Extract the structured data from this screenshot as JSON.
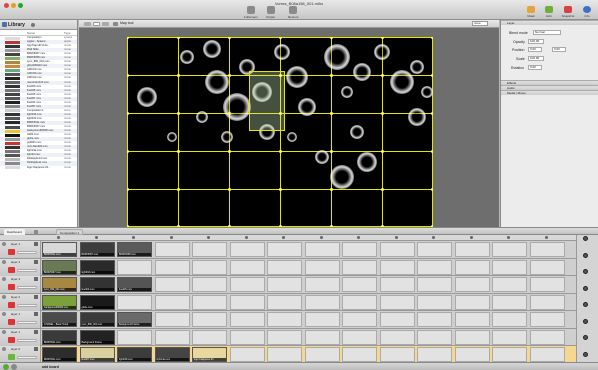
{
  "window": {
    "title": "Vorma_B08a158_001.mlhs"
  },
  "toolbar": {
    "buttons": [
      {
        "label": "Fullscreen"
      },
      {
        "label": "Output"
      },
      {
        "label": "Restore"
      }
    ],
    "right_buttons": [
      {
        "label": "Mask",
        "color": "#e9a23b"
      },
      {
        "label": "Edit",
        "color": "#6fae3a"
      },
      {
        "label": "Snapshot",
        "color": "#d94040"
      },
      {
        "label": "Info",
        "color": "#3a72c8"
      }
    ]
  },
  "library": {
    "title": "Library",
    "col_name": "Name",
    "col_type": "Type",
    "items": [
      {
        "name": "Composition",
        "type": "system",
        "thumb": "#ddd"
      },
      {
        "name": "Applet - Spawn/...",
        "type": "applet",
        "thumb": "#b33"
      },
      {
        "name": "AppTrap HD Outs...",
        "type": "movie",
        "thumb": "#333"
      },
      {
        "name": "iPad Slide",
        "type": "movie",
        "thumb": "#999"
      },
      {
        "name": "BD0K5067.mov",
        "type": "movie",
        "thumb": "#444"
      },
      {
        "name": "BD0K5068.mov",
        "type": "movie",
        "thumb": "#8a6"
      },
      {
        "name": "sync_890_001.mov",
        "type": "movie",
        "thumb": "#a84"
      },
      {
        "name": "g0ny0000A0.mov",
        "type": "movie",
        "thumb": "#c83"
      },
      {
        "name": "cd0C43.mov",
        "type": "movie",
        "thumb": "#6a8"
      },
      {
        "name": "cd0C45.mov",
        "type": "movie",
        "thumb": "#555"
      },
      {
        "name": "cd0C44.mov",
        "type": "movie",
        "thumb": "#222"
      },
      {
        "name": "macroVert134.mov",
        "type": "movie",
        "thumb": "#666"
      },
      {
        "name": "line000.mov",
        "type": "movie",
        "thumb": "#333"
      },
      {
        "name": "line025.mov",
        "type": "movie",
        "thumb": "#777"
      },
      {
        "name": "line026.mov",
        "type": "movie",
        "thumb": "#444"
      },
      {
        "name": "line007.mov",
        "type": "movie",
        "thumb": "#555"
      },
      {
        "name": "line041.mov",
        "type": "movie",
        "thumb": "#222"
      },
      {
        "name": "line057.mov",
        "type": "movie",
        "thumb": "#888"
      },
      {
        "name": "Composition 1",
        "type": "comp",
        "thumb": "#ccc"
      },
      {
        "name": "light018.mov",
        "type": "movie",
        "thumb": "#333"
      },
      {
        "name": "light022.mov",
        "type": "movie",
        "thumb": "#555"
      },
      {
        "name": "BD0K5011.mov",
        "type": "movie",
        "thumb": "#2a2a2a"
      },
      {
        "name": "BD0K5067.mov",
        "type": "movie",
        "thumb": "#4a4a4a"
      },
      {
        "name": "background00000.mov",
        "type": "movie",
        "thumb": "#e8c43a"
      },
      {
        "name": "Hd02.mov",
        "type": "movie",
        "thumb": "#111"
      },
      {
        "name": "globe.mov",
        "type": "movie",
        "thumb": "#999"
      },
      {
        "name": "go0001.mov",
        "type": "movie",
        "thumb": "#c33"
      },
      {
        "name": "num-blank03.mov",
        "type": "movie",
        "thumb": "#333"
      },
      {
        "name": "light14a.mov",
        "type": "movie",
        "thumb": "#777"
      },
      {
        "name": "light20.mov",
        "type": "movie",
        "thumb": "#555"
      },
      {
        "name": "DickApple14.mov",
        "type": "movie",
        "thumb": "#bbb"
      },
      {
        "name": "DickApple11.mov",
        "type": "movie",
        "thumb": "#888"
      },
      {
        "name": "logo Clappeme 04...",
        "type": "movie",
        "thumb": "#ddd"
      }
    ]
  },
  "viewer": {
    "label": "Map tool",
    "zoom": "none"
  },
  "inspector": {
    "section": "Layer",
    "blend_mode_label": "Blend mode",
    "blend_mode": "Normal",
    "opacity_label": "Opacity",
    "opacity": "100.00",
    "position_label": "Position",
    "position_x": "0.00",
    "position_y": "0.00",
    "scale_label": "Scale",
    "scale": "100.00",
    "rotation_label": "Rotation",
    "rotation": "0.00",
    "sections": [
      "Effects",
      "Audio",
      "Media | Movie"
    ]
  },
  "dashboard": {
    "tabs": [
      {
        "label": "Dashboard"
      },
      {
        "label": "Composition 1"
      }
    ],
    "add_label": "add board",
    "layers": [
      {
        "name": "layer 1",
        "bg": "#cfcfcf",
        "clips": [
          {
            "col": 0,
            "label": "BD0K5011.mov",
            "color": "#d8d8d8"
          },
          {
            "col": 1,
            "label": "BD0K5067.mov",
            "color": "#3d3d3d"
          },
          {
            "col": 2,
            "label": "BD0K5068.mov",
            "color": "#5a5a5a"
          }
        ]
      },
      {
        "name": "layer 4",
        "bg": "#cfcfcf",
        "clips": [
          {
            "col": 0,
            "label": "BD0K5067.mov",
            "color": "#6a7a55"
          },
          {
            "col": 1,
            "label": "light018.mov",
            "color": "#2a2a2a"
          }
        ]
      },
      {
        "name": "layer 3",
        "bg": "#cfcfcf",
        "clips": [
          {
            "col": 0,
            "label": "sync_890_001.mov",
            "color": "#a88840"
          },
          {
            "col": 1,
            "label": "line000.mov",
            "color": "#333"
          },
          {
            "col": 2,
            "label": "line025.mov",
            "color": "#555"
          }
        ]
      },
      {
        "name": "layer 2",
        "bg": "#cfcfcf",
        "clips": [
          {
            "col": 0,
            "label": "background00000.mov",
            "color": "#7ca03a"
          },
          {
            "col": 1,
            "label": "globe.mov",
            "color": "#1a1a1a"
          }
        ]
      },
      {
        "name": "layer 1",
        "bg": "#cfcfcf",
        "clips": [
          {
            "col": 0,
            "label": "CHANEL - Basic Track",
            "color": "#4a4a4a"
          },
          {
            "col": 1,
            "label": "sync_890_001.mov",
            "color": "#3a3a3a"
          },
          {
            "col": 2,
            "label": "Background Frame",
            "color": "#6a6a6a"
          }
        ]
      },
      {
        "name": "layer 1",
        "bg": "#cfcfcf",
        "clips": [
          {
            "col": 0,
            "label": "BD0K5011.mov",
            "color": "#3a3a3a"
          },
          {
            "col": 1,
            "label": "Background Frame",
            "color": "#222"
          }
        ]
      },
      {
        "name": "layer 0",
        "bg": "#f5d890",
        "clips": [
          {
            "col": 0,
            "label": "BD0K5011.mov",
            "color": "#2d2d2d"
          },
          {
            "col": 1,
            "label": "line007.mov",
            "color": "#d8d0a0"
          },
          {
            "col": 2,
            "label": "light018.mov",
            "color": "#3c3c3c"
          },
          {
            "col": 3,
            "label": "light14a.mov",
            "color": "#444"
          },
          {
            "col": 4,
            "label": "logo Clappeme 04",
            "color": "#e8d8a0"
          }
        ]
      }
    ]
  }
}
